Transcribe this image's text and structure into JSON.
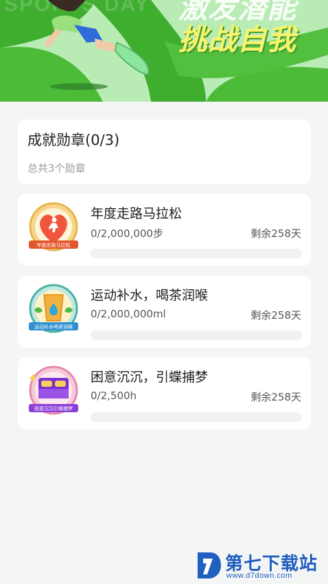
{
  "banner": {
    "bg_text": "SPORTS DAY",
    "line1": "激发潜能",
    "line2": "挑战自我"
  },
  "summary": {
    "title": "成就勋章(0/3)",
    "subtitle": "总共3个勋章"
  },
  "medals": [
    {
      "name": "年度走路马拉松",
      "progress": "0/2,000,000步",
      "remaining": "剩余258天",
      "badge_ribbon": "年度走路马拉松",
      "progress_value": 0
    },
    {
      "name": "运动补水，喝茶润喉",
      "progress": "0/2,000,000ml",
      "remaining": "剩余258天",
      "badge_ribbon": "运动补水喝茶润喉",
      "progress_value": 0
    },
    {
      "name": "困意沉沉，引蝶捕梦",
      "progress": "0/2,500h",
      "remaining": "剩余258天",
      "badge_ribbon": "困意沉沉引蝶捕梦",
      "progress_value": 0
    }
  ],
  "watermark": {
    "title": "第七下载站",
    "url": "www.d7down.com"
  },
  "colors": {
    "banner_green": "#3fae2f",
    "accent_yellow": "#f8f36c",
    "progress_track": "#f1f1f1"
  }
}
